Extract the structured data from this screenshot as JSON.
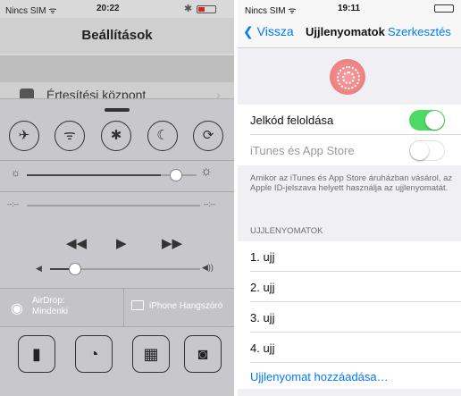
{
  "left": {
    "status": {
      "carrier": "Nincs SIM ᯤ",
      "time": "20:22"
    },
    "nav_title": "Beállítások",
    "settings_row_label": "Értesítési központ",
    "control_center": {
      "toggles": [
        "airplane-icon",
        "wifi-icon",
        "bluetooth-icon",
        "moon-icon",
        "rotation-lock-icon"
      ],
      "brightness": 0.73,
      "time_start": "--:--",
      "time_end": "--:--",
      "volume": 0.18,
      "airdrop_line1": "AirDrop:",
      "airdrop_line2": "Mindenki",
      "speaker_label": "iPhone Hangszóró",
      "tools": [
        "flashlight-icon",
        "timer-icon",
        "calculator-icon",
        "camera-icon"
      ]
    }
  },
  "right": {
    "status": {
      "carrier": "Nincs SIM ᯤ",
      "time": "19:11"
    },
    "nav": {
      "back": "Vissza",
      "title": "Ujjlenyomatok",
      "edit": "Szerkesztés"
    },
    "passcode_unlock": {
      "label": "Jelkód feloldása",
      "on": true
    },
    "itunes_store": {
      "label": "iTunes és App Store",
      "on": false
    },
    "note": "Amikor az iTunes és App Store áruházban vásárol, az Apple ID-jelszava helyett használja az ujjlenyomatát.",
    "section_header": "UJJLENYOMATOK",
    "fingers": [
      "1. ujj",
      "2. ujj",
      "3. ujj",
      "4. ujj"
    ],
    "add_label": "Ujjlenyomat hozzáadása…",
    "colors": {
      "accent": "#007aff",
      "switch_on": "#4cd964"
    }
  }
}
